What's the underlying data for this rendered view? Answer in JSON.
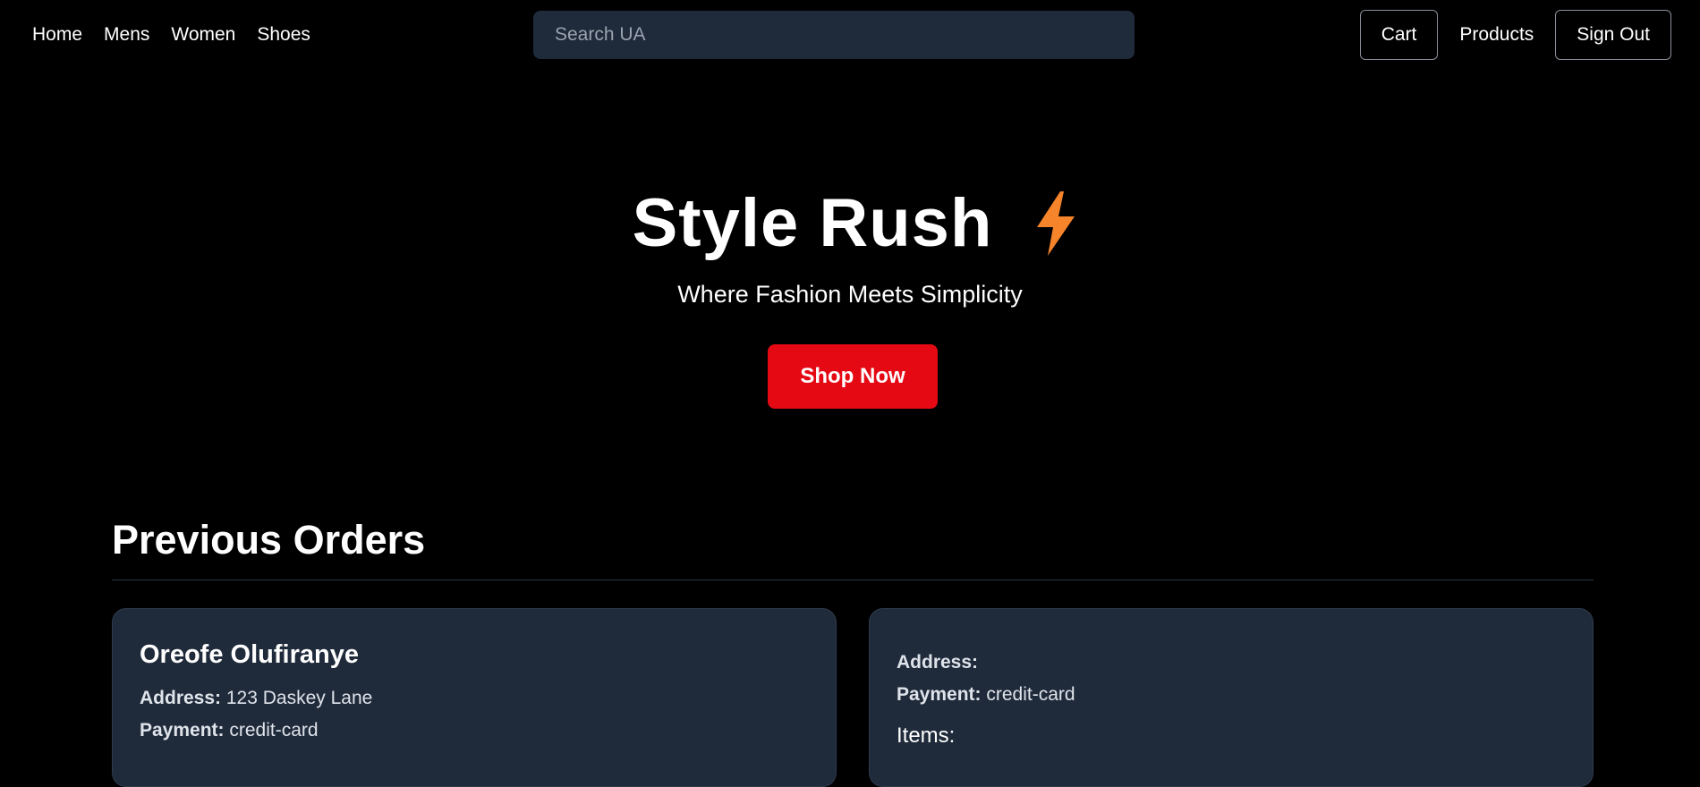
{
  "nav": {
    "links": [
      "Home",
      "Mens",
      "Women",
      "Shoes"
    ],
    "search_placeholder": "Search UA",
    "cart_label": "Cart",
    "products_label": "Products",
    "signout_label": "Sign Out"
  },
  "hero": {
    "title": "Style Rush",
    "icon": "lightning-bolt-icon",
    "subtitle": "Where Fashion Meets Simplicity",
    "cta_label": "Shop Now"
  },
  "orders": {
    "heading": "Previous Orders",
    "cards": [
      {
        "name": "Oreofe Olufiranye",
        "address_label": "Address:",
        "address": "123 Daskey Lane",
        "payment_label": "Payment:",
        "payment": "credit-card"
      },
      {
        "name": "",
        "address_label": "Address:",
        "address": "",
        "payment_label": "Payment:",
        "payment": "credit-card",
        "items_label": "Items:"
      }
    ]
  },
  "colors": {
    "background": "#000000",
    "surface": "#1f2a3a",
    "accent_red": "#e50914",
    "bolt_orange": "#f5842b"
  }
}
